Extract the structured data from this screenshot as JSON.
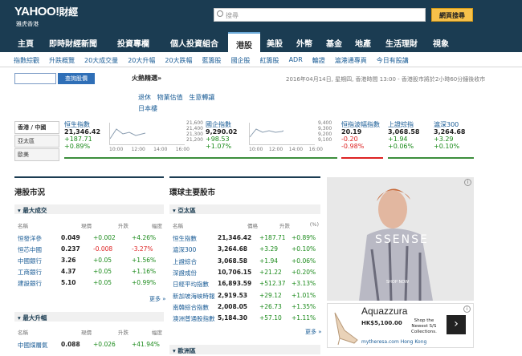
{
  "header": {
    "logo": "YAHOO!",
    "logo_cn": "財經",
    "region": "雅虎香港",
    "search_placeholder": "搜尋",
    "search_button": "網頁搜尋"
  },
  "nav": [
    {
      "label": "主頁",
      "w": 36
    },
    {
      "label": "即時財經新聞",
      "w": 82
    },
    {
      "label": "投資專欄",
      "w": 68
    },
    {
      "label": "個人投資組合",
      "w": 84
    },
    {
      "label": "港股",
      "w": 40,
      "active": true
    },
    {
      "label": "美股",
      "w": 36
    },
    {
      "label": "外幣",
      "w": 38
    },
    {
      "label": "基金",
      "w": 36
    },
    {
      "label": "地產",
      "w": 36
    },
    {
      "label": "生活理財",
      "w": 60
    },
    {
      "label": "視象",
      "w": 38
    }
  ],
  "subnav": [
    "指數綜觀",
    "升跌概覽",
    "20大成交量",
    "20大升幅",
    "20大跌幅",
    "藍籌股",
    "國企股",
    "紅籌股",
    "ADR",
    "輪證",
    "滬港通專頁",
    "今日有股講"
  ],
  "quote": {
    "button": "查詢股價"
  },
  "hot": {
    "title": "火熱精選»",
    "links": [
      "退休",
      "物業估值",
      "生意轉讓",
      "日本樓"
    ]
  },
  "date": "2016年04月14日, 星期四, 香港時間 13:00 - 香港股市將於2小時60分鐘後收市",
  "tabs": [
    "香港 / 中國",
    "亞太區",
    "歐美"
  ],
  "indices": [
    {
      "name": "恒生指數",
      "value": "21,346.42",
      "change": "+187.71",
      "pct": "+0.89%"
    },
    {
      "name": "國企指數",
      "value": "9,290.02",
      "change": "+98.53",
      "pct": "+1.07%"
    },
    {
      "name": "恒指波幅指數",
      "value": "20.19",
      "change": "-0.20",
      "pct": "-0.98%"
    },
    {
      "name": "上證綜指",
      "value": "3,068.58",
      "change": "+1.94",
      "pct": "+0.06%"
    },
    {
      "name": "滬深300",
      "value": "3,264.68",
      "change": "+3.29",
      "pct": "+0.10%"
    }
  ],
  "chart1": {
    "y": [
      "21,600",
      "21,400",
      "21,300",
      "21,200"
    ],
    "x": [
      "10:00",
      "12:00",
      "14:00",
      "16:00"
    ]
  },
  "chart2": {
    "y": [
      "9,400",
      "9,300",
      "9,200",
      "9,100"
    ],
    "x": [
      "10:00",
      "12:00",
      "14:00",
      "16:00"
    ]
  },
  "hk": {
    "title": "港股市況",
    "band1": "最大成交",
    "band2": "最大升幅",
    "cols": [
      "名稱",
      "現價",
      "升跌",
      "幅度"
    ],
    "more": "更多 »",
    "rows": [
      [
        "恒發洋參",
        "0.049",
        "+0.002",
        "+4.26%"
      ],
      [
        "恒芯中國",
        "0.237",
        "-0.008",
        "-3.27%"
      ],
      [
        "中國銀行",
        "3.26",
        "+0.05",
        "+1.56%"
      ],
      [
        "工商銀行",
        "4.37",
        "+0.05",
        "+1.16%"
      ],
      [
        "建設銀行",
        "5.10",
        "+0.05",
        "+0.99%"
      ]
    ],
    "rows2": [
      [
        "中國煤層氣",
        "0.088",
        "+0.026",
        "+41.94%"
      ]
    ]
  },
  "world": {
    "title": "環球主要股市",
    "band1": "亞太區",
    "band2": "歐洲區",
    "cols": [
      "名稱",
      "價格",
      "升跌",
      "(%)"
    ],
    "more": "更多 »",
    "rows": [
      [
        "恒生指數",
        "21,346.42",
        "+187.71",
        "+0.89%"
      ],
      [
        "滬深300",
        "3,264.68",
        "+3.29",
        "+0.10%"
      ],
      [
        "上證綜合",
        "3,068.58",
        "+1.94",
        "+0.06%"
      ],
      [
        "深證成份",
        "10,706.15",
        "+21.22",
        "+0.20%"
      ],
      [
        "日經平均指數",
        "16,893.59",
        "+512.37",
        "+3.13%"
      ],
      [
        "新加坡海峽時報",
        "2,919.53",
        "+29.12",
        "+1.01%"
      ],
      [
        "南韓綜合指數",
        "2,008.05",
        "+26.73",
        "+1.35%"
      ],
      [
        "澳洲普通股指數",
        "5,184.30",
        "+57.10",
        "+1.11%"
      ]
    ]
  },
  "ad1": {
    "text": "SSENSE",
    "small": "SHOP NOW"
  },
  "ad2": {
    "brand": "Aquazzura",
    "shop": "Shop the",
    "newest": "Newest S/S",
    "coll": "Collections.",
    "price": "HK$5,100.00",
    "url": "mytheresa.com Hong Kong"
  }
}
